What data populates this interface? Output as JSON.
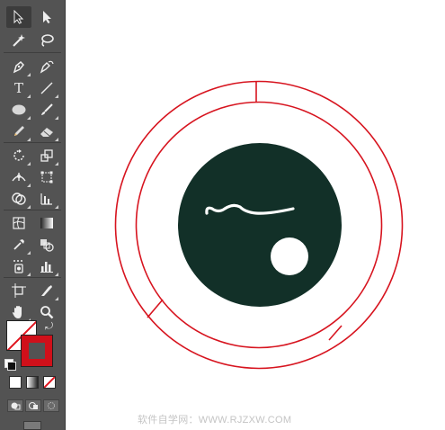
{
  "toolbar": {
    "tools": [
      {
        "name": "selection-tool",
        "icon": "arrow-icon"
      },
      {
        "name": "direct-selection-tool",
        "icon": "white-arrow-icon"
      },
      {
        "name": "magic-wand-tool",
        "icon": "magic-wand-icon"
      },
      {
        "name": "lasso-tool",
        "icon": "lasso-icon"
      },
      {
        "name": "pen-tool",
        "icon": "pen-icon"
      },
      {
        "name": "curvature-tool",
        "icon": "curvature-pen-icon"
      },
      {
        "name": "type-tool",
        "icon": "type-icon",
        "glyph": "T"
      },
      {
        "name": "line-segment-tool",
        "icon": "line-icon"
      },
      {
        "name": "ellipse-tool",
        "icon": "ellipse-icon"
      },
      {
        "name": "paintbrush-tool",
        "icon": "brush-icon"
      },
      {
        "name": "pencil-tool",
        "icon": "pencil-icon"
      },
      {
        "name": "eraser-tool",
        "icon": "eraser-icon"
      },
      {
        "name": "rotate-tool",
        "icon": "rotate-icon"
      },
      {
        "name": "scale-tool",
        "icon": "scale-icon"
      },
      {
        "name": "width-tool",
        "icon": "width-icon"
      },
      {
        "name": "free-transform-tool",
        "icon": "free-transform-icon"
      },
      {
        "name": "shape-builder-tool",
        "icon": "shape-builder-icon"
      },
      {
        "name": "graph-tool",
        "icon": "column-graph-icon"
      },
      {
        "name": "mesh-tool",
        "icon": "mesh-icon"
      },
      {
        "name": "gradient-tool",
        "icon": "gradient-icon"
      },
      {
        "name": "eyedropper-tool",
        "icon": "eyedropper-icon"
      },
      {
        "name": "blend-tool",
        "icon": "blend-icon"
      },
      {
        "name": "symbol-sprayer-tool",
        "icon": "symbol-sprayer-icon"
      },
      {
        "name": "column-graph-tool",
        "icon": "bar-chart-icon"
      },
      {
        "name": "artboard-tool",
        "icon": "artboard-icon"
      },
      {
        "name": "slice-tool",
        "icon": "knife-icon"
      },
      {
        "name": "hand-tool",
        "icon": "hand-icon"
      },
      {
        "name": "zoom-tool",
        "icon": "magnifier-icon"
      }
    ],
    "fill_color": "none",
    "stroke_color": "#d0101a"
  },
  "colors": {
    "ring_stroke": "#d7141f",
    "face_fill": "#123028",
    "eye_fill": "#ffffff"
  },
  "watermark": "软件自学网：WWW.RJZXW.COM"
}
